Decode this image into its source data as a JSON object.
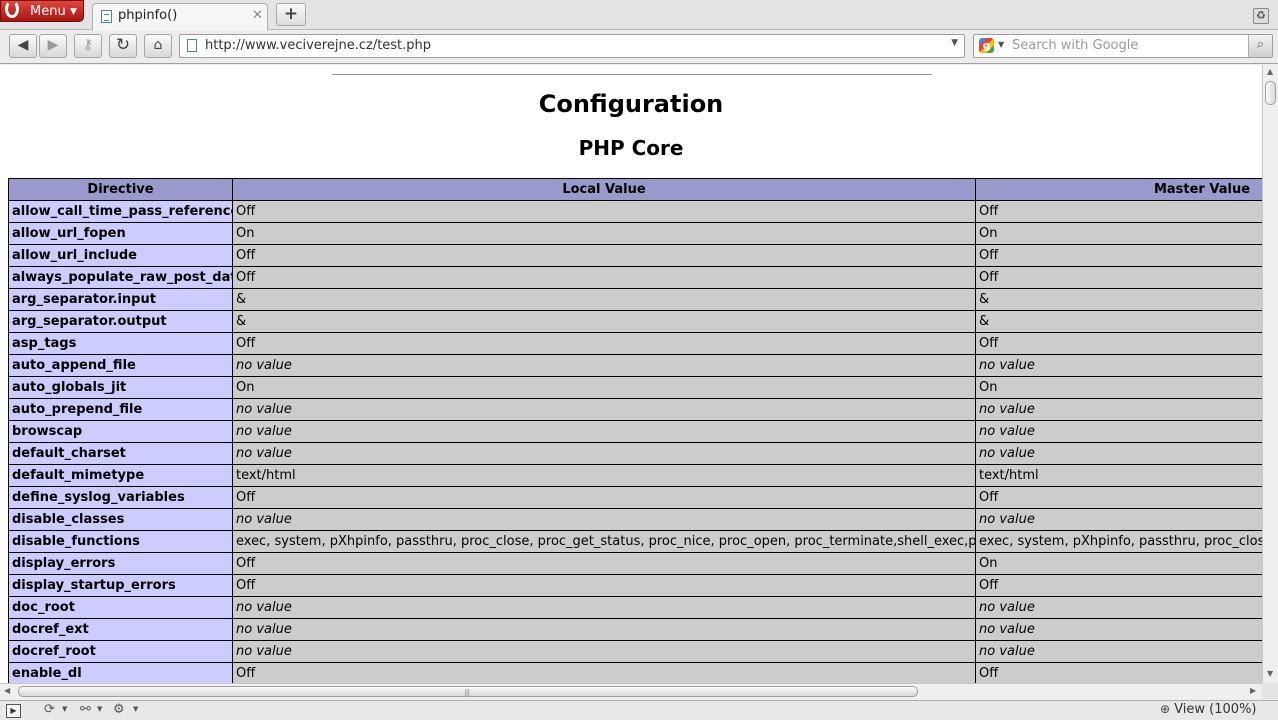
{
  "browser": {
    "menu_label": "Menu",
    "tab_title": "phpinfo()",
    "new_tab_symbol": "+",
    "url": "http://www.veciverejne.cz/test.php",
    "search_placeholder": "Search with Google",
    "zoom_label": "View (100%)"
  },
  "page": {
    "heading": "Configuration",
    "subheading": "PHP Core",
    "headers": [
      "Directive",
      "Local Value",
      "Master Value"
    ],
    "rows": [
      {
        "directive": "allow_call_time_pass_reference",
        "local": "Off",
        "master": "Off",
        "nv": false
      },
      {
        "directive": "allow_url_fopen",
        "local": "On",
        "master": "On",
        "nv": false
      },
      {
        "directive": "allow_url_include",
        "local": "Off",
        "master": "Off",
        "nv": false
      },
      {
        "directive": "always_populate_raw_post_data",
        "local": "Off",
        "master": "Off",
        "nv": false
      },
      {
        "directive": "arg_separator.input",
        "local": "&",
        "master": "&",
        "nv": false
      },
      {
        "directive": "arg_separator.output",
        "local": "&",
        "master": "&",
        "nv": false
      },
      {
        "directive": "asp_tags",
        "local": "Off",
        "master": "Off",
        "nv": false
      },
      {
        "directive": "auto_append_file",
        "local": "no value",
        "master": "no value",
        "nv": true
      },
      {
        "directive": "auto_globals_jit",
        "local": "On",
        "master": "On",
        "nv": false
      },
      {
        "directive": "auto_prepend_file",
        "local": "no value",
        "master": "no value",
        "nv": true
      },
      {
        "directive": "browscap",
        "local": "no value",
        "master": "no value",
        "nv": true
      },
      {
        "directive": "default_charset",
        "local": "no value",
        "master": "no value",
        "nv": true
      },
      {
        "directive": "default_mimetype",
        "local": "text/html",
        "master": "text/html",
        "nv": false
      },
      {
        "directive": "define_syslog_variables",
        "local": "Off",
        "master": "Off",
        "nv": false
      },
      {
        "directive": "disable_classes",
        "local": "no value",
        "master": "no value",
        "nv": true
      },
      {
        "directive": "disable_functions",
        "local": "exec, system, pXhpinfo, passthru, proc_close, proc_get_status, proc_nice, proc_open, proc_terminate,shell_exec,popen,dl",
        "master": "exec, system, pXhpinfo, passthru, proc_close, proc_get_status, proc_nice, proc_open, proc_terminate,shell_exec,popen,dl",
        "nv": false
      },
      {
        "directive": "display_errors",
        "local": "Off",
        "master": "On",
        "nv": false
      },
      {
        "directive": "display_startup_errors",
        "local": "Off",
        "master": "Off",
        "nv": false
      },
      {
        "directive": "doc_root",
        "local": "no value",
        "master": "no value",
        "nv": true
      },
      {
        "directive": "docref_ext",
        "local": "no value",
        "master": "no value",
        "nv": true
      },
      {
        "directive": "docref_root",
        "local": "no value",
        "master": "no value",
        "nv": true
      },
      {
        "directive": "enable_dl",
        "local": "Off",
        "master": "Off",
        "nv": false
      }
    ]
  },
  "colors": {
    "header_bg": "#9999cc",
    "directive_bg": "#ccccff",
    "value_bg": "#cccccc",
    "menu_red": "#c8241c"
  },
  "icons": {
    "back": "back-arrow-icon",
    "forward": "forward-arrow-icon",
    "key": "key-icon",
    "reload": "reload-icon",
    "home": "home-icon",
    "search": "magnifier-icon",
    "trash": "closed-tabs-trash-icon"
  }
}
